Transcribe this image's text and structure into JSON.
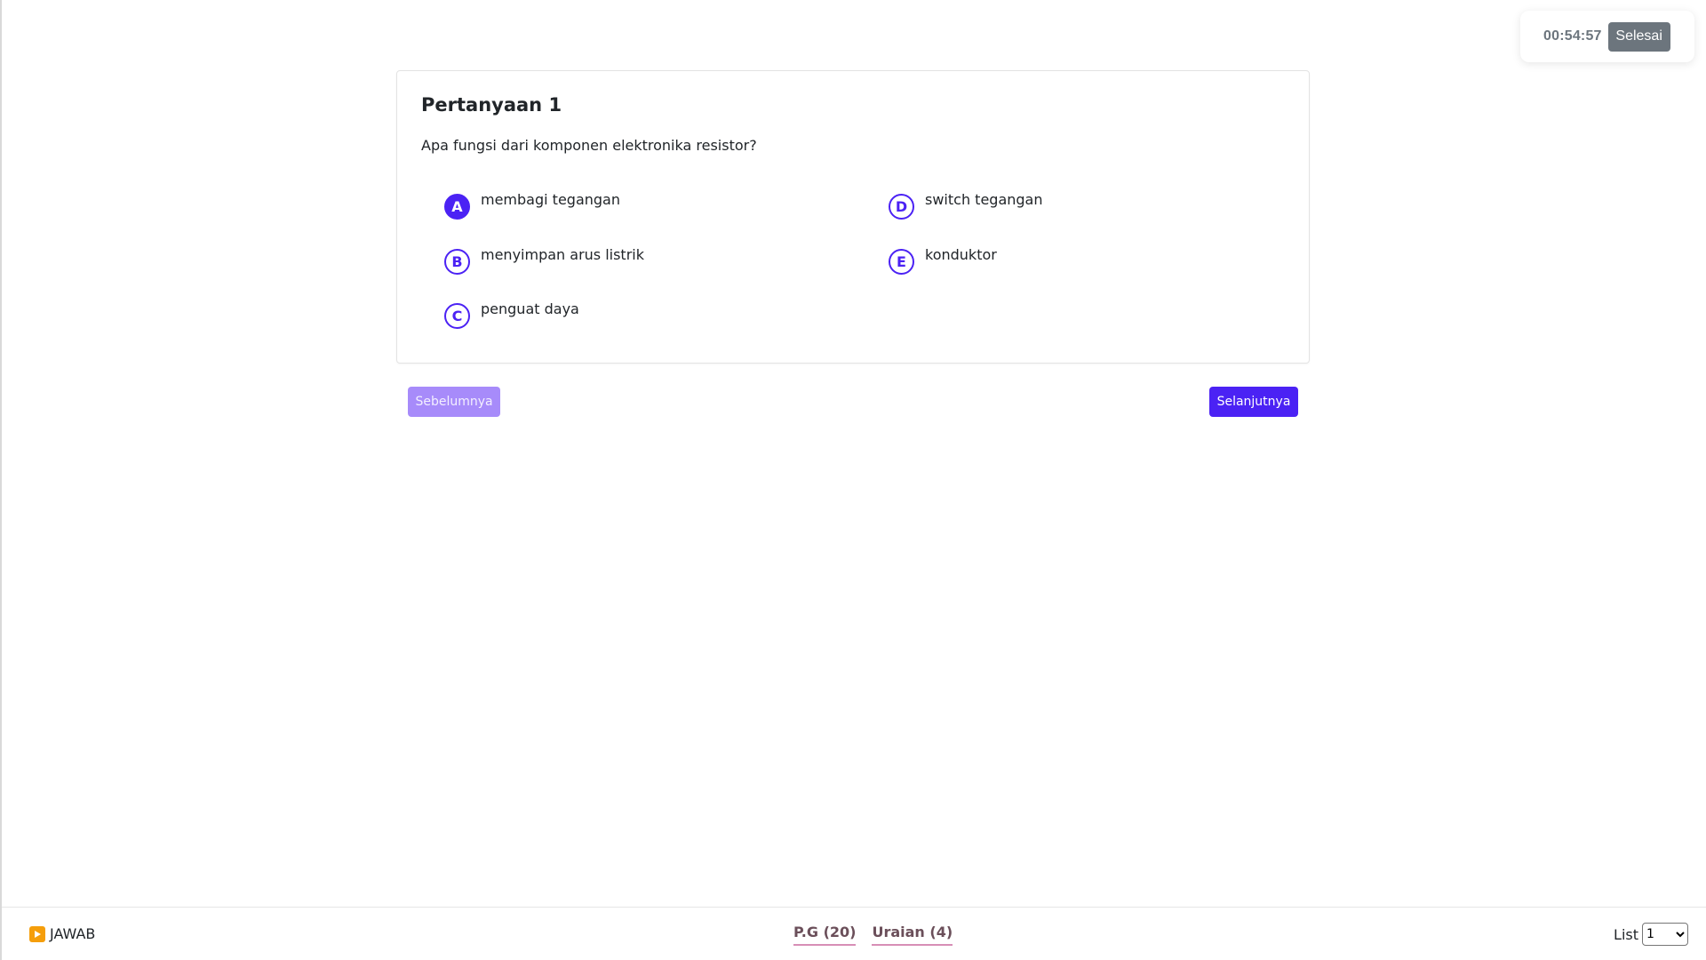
{
  "timer": {
    "time": "00:54:57",
    "finish_label": "Selesai"
  },
  "question": {
    "title": "Pertanyaan 1",
    "text": "Apa fungsi dari komponen elektronika resistor?",
    "selected": "A",
    "options": [
      {
        "letter": "A",
        "text": "membagi tegangan"
      },
      {
        "letter": "B",
        "text": "menyimpan arus listrik"
      },
      {
        "letter": "C",
        "text": "penguat daya"
      },
      {
        "letter": "D",
        "text": "switch tegangan"
      },
      {
        "letter": "E",
        "text": "konduktor"
      }
    ]
  },
  "nav": {
    "prev_label": "Sebelumnya",
    "next_label": "Selanjutnya"
  },
  "footer": {
    "jawab_label": "JAWAB",
    "jawab_icon": "play-icon",
    "tabs": [
      {
        "label": "P.G (20)"
      },
      {
        "label": "Uraian (4)"
      }
    ],
    "list_label": "List",
    "list_value": "1"
  },
  "colors": {
    "accent": "#4b22f4",
    "prev_button": "#a78bfa",
    "finish_button": "#6c757d",
    "play_icon": "#f59e0b",
    "tab_underline": "#d78fb6"
  }
}
